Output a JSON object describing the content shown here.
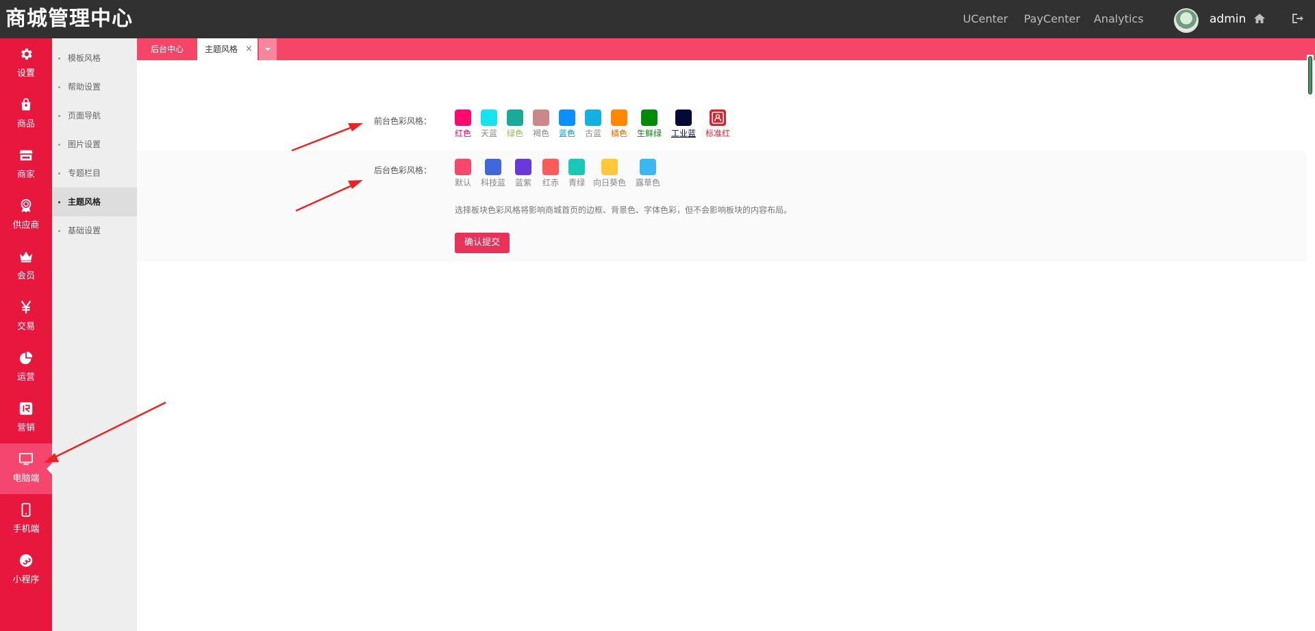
{
  "header": {
    "brand": "商城管理中心",
    "links": [
      "UCenter",
      "PayCenter",
      "Analytics"
    ],
    "user": "admin",
    "icons": [
      "home-icon",
      "logout-icon"
    ]
  },
  "sidebar": {
    "items": [
      {
        "label": "设置",
        "icon": "gear-icon"
      },
      {
        "label": "商品",
        "icon": "shopping-bag-icon"
      },
      {
        "label": "商家",
        "icon": "store-icon"
      },
      {
        "label": "供应商",
        "icon": "award-icon"
      },
      {
        "label": "会员",
        "icon": "crown-icon"
      },
      {
        "label": "交易",
        "icon": "yen-icon"
      },
      {
        "label": "运营",
        "icon": "pie-chart-icon"
      },
      {
        "label": "营销",
        "icon": "promo-icon"
      },
      {
        "label": "电脑端",
        "icon": "monitor-icon",
        "active": true
      },
      {
        "label": "手机端",
        "icon": "mobile-icon"
      },
      {
        "label": "小程序",
        "icon": "mini-program-icon"
      }
    ]
  },
  "subnav": {
    "items": [
      {
        "label": "模板风格"
      },
      {
        "label": "帮助设置"
      },
      {
        "label": "页面导航"
      },
      {
        "label": "图片设置"
      },
      {
        "label": "专题栏目"
      },
      {
        "label": "主题风格",
        "active": true
      },
      {
        "label": "基础设置"
      }
    ]
  },
  "tabs": {
    "home": "后台中心",
    "active": "主题风格",
    "close": "×"
  },
  "theme": {
    "front_label": "前台色彩风格：",
    "front_colors": [
      {
        "name": "红色",
        "color": "#ff0a6f",
        "text_color": "#ff0a6f"
      },
      {
        "name": "天蓝",
        "color": "#14e3f0",
        "text_color": "#888888"
      },
      {
        "name": "绿色",
        "color": "#1aaa98",
        "text_color": "#8bc34a"
      },
      {
        "name": "褐色",
        "color": "#cc8888",
        "text_color": "#888888"
      },
      {
        "name": "蓝色",
        "color": "#0a90ff",
        "text_color": "#0a90ff"
      },
      {
        "name": "古蓝",
        "color": "#14b0e0",
        "text_color": "#888888"
      },
      {
        "name": "橘色",
        "color": "#ff8800",
        "text_color": "#ff6600"
      },
      {
        "name": "生鲜绿",
        "color": "#008a0a",
        "text_color": "#008a0a"
      },
      {
        "name": "工业蓝",
        "color": "#040a38",
        "text_color": "#040a38",
        "underline": true
      },
      {
        "name": "标准红",
        "color": "#e0202e",
        "text_color": "#e0202e",
        "icon": "user-badge-icon"
      }
    ],
    "back_label": "后台色彩风格：",
    "back_colors": [
      {
        "name": "默认",
        "color": "#f5486a"
      },
      {
        "name": "科技蓝",
        "color": "#4068d8"
      },
      {
        "name": "蓝紫",
        "color": "#6a3ad8"
      },
      {
        "name": "红赤",
        "color": "#fa5a5a"
      },
      {
        "name": "青绿",
        "color": "#1ac8b8"
      },
      {
        "name": "向日葵色",
        "color": "#ffc83a"
      },
      {
        "name": "露草色",
        "color": "#3ab8f0"
      }
    ],
    "note": "选择板块色彩风格将影响商城首页的边框、背景色、字体色彩，但不会影响板块的内容布局。",
    "submit": "确认提交"
  }
}
